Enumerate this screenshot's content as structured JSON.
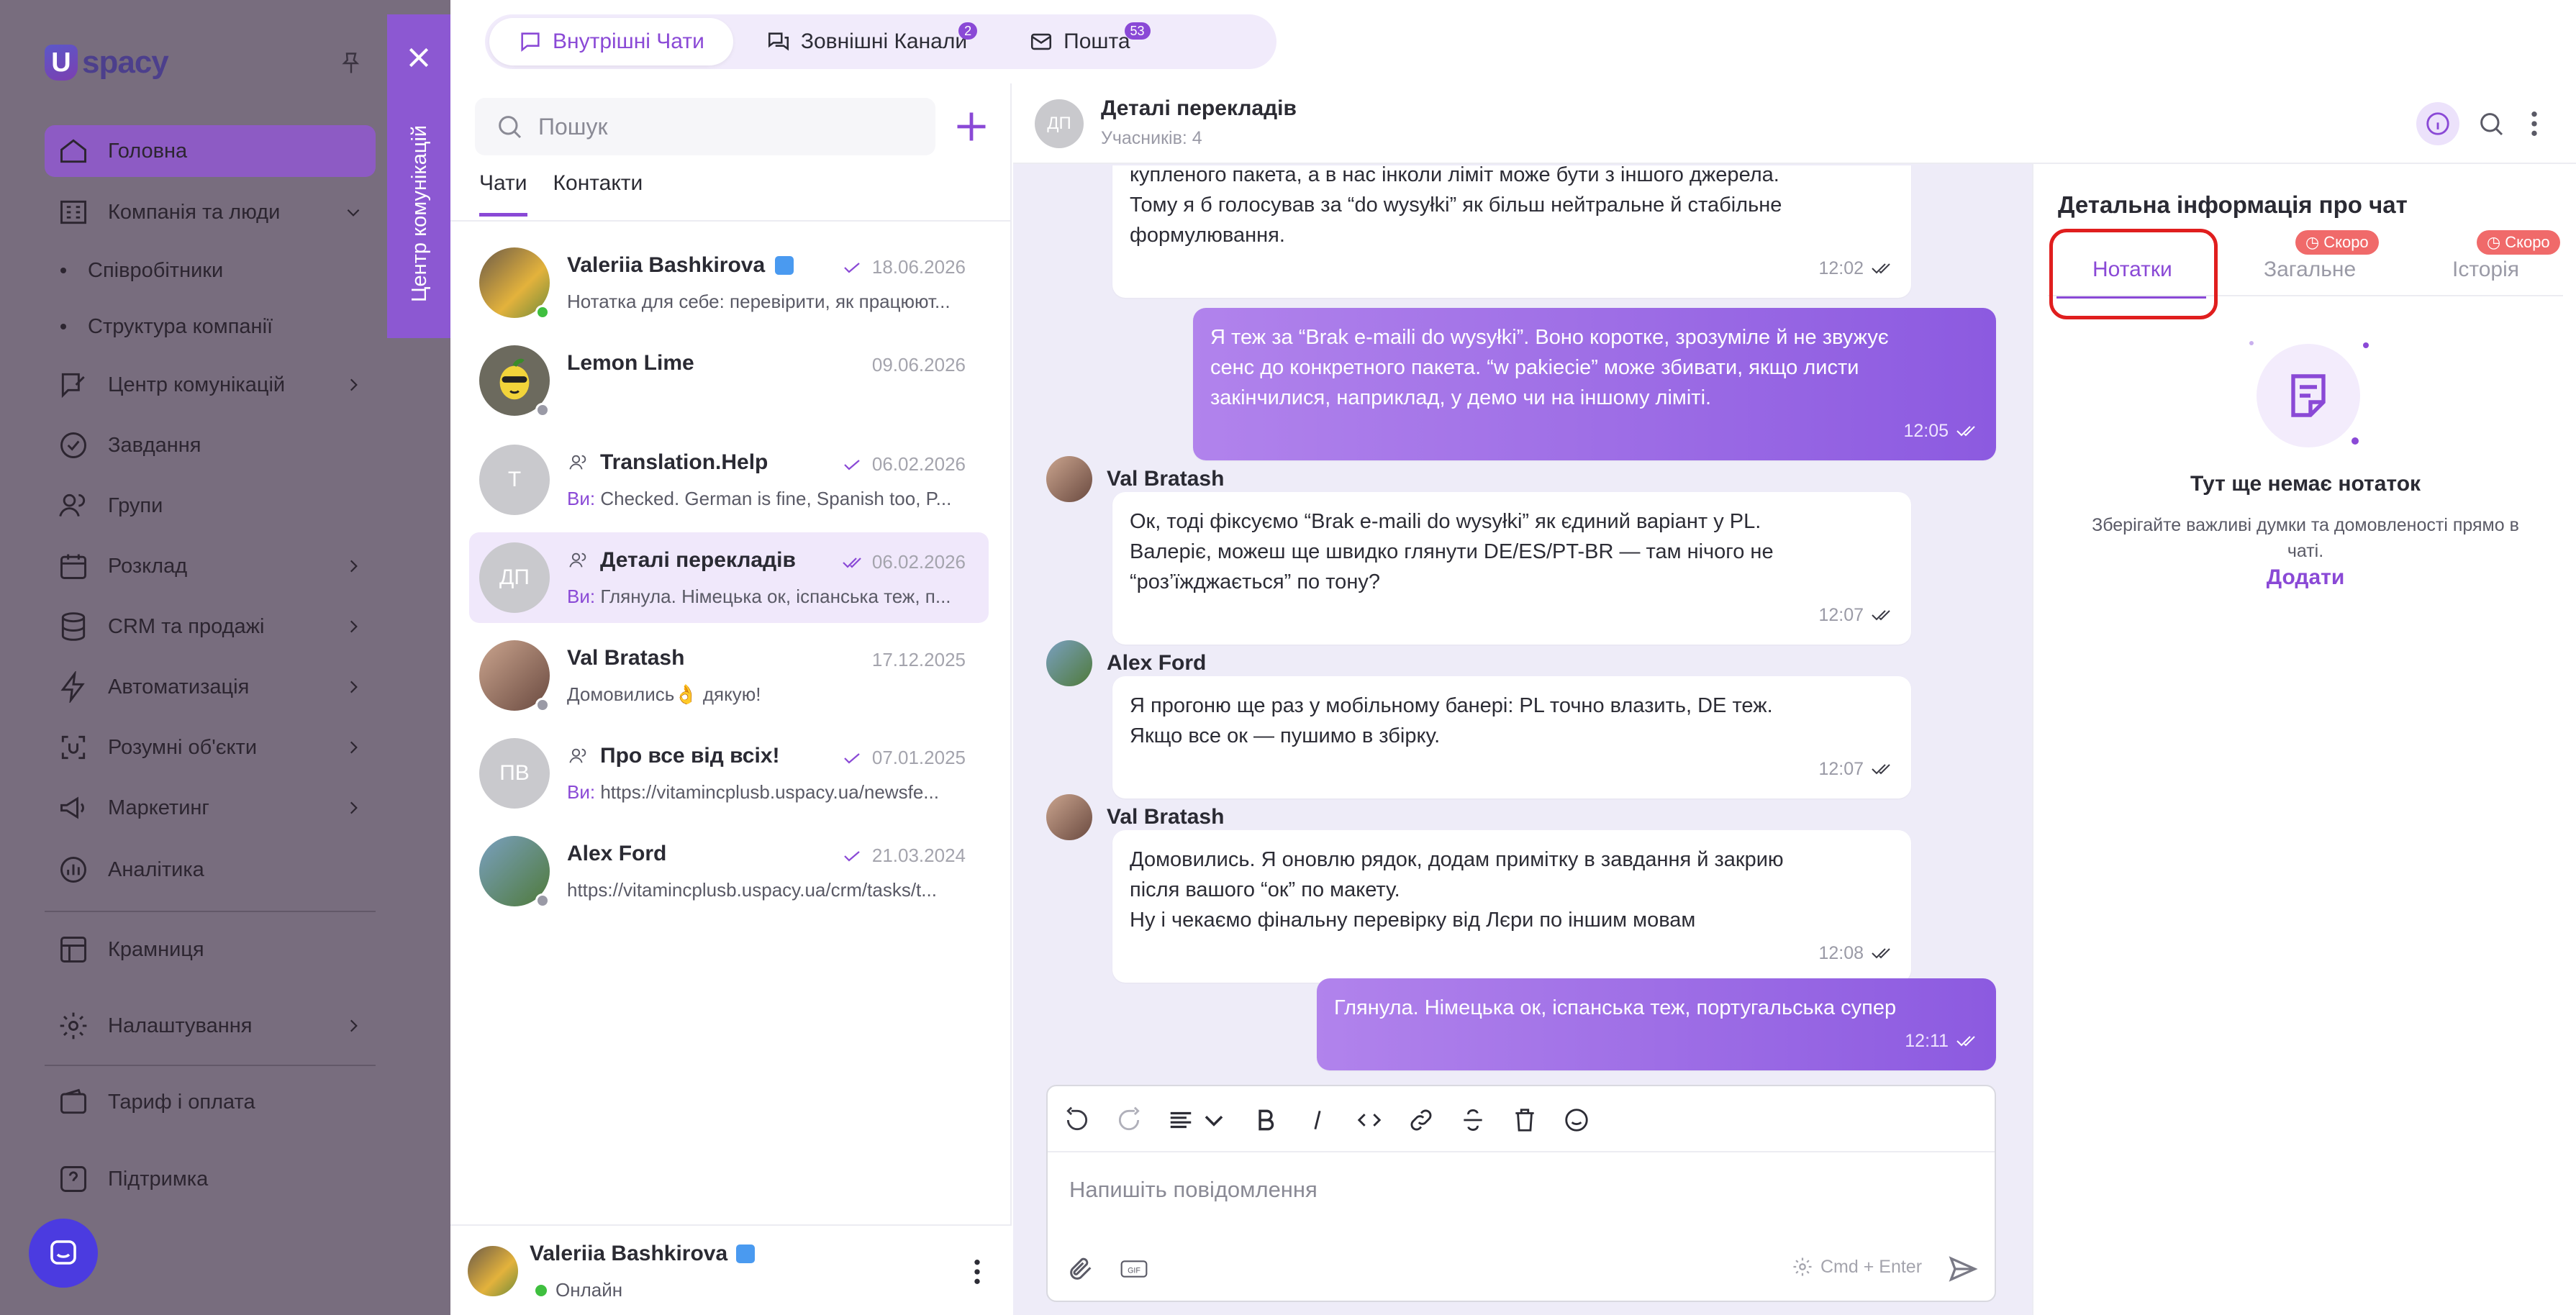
{
  "sidebar": {
    "logo_mark": "U",
    "logo_text": "spacy",
    "items": [
      {
        "label": "Головна"
      },
      {
        "label": "Компанія та люди"
      },
      {
        "label": "Співробітники"
      },
      {
        "label": "Структура компанії"
      },
      {
        "label": "Центр комунікацій"
      },
      {
        "label": "Завдання"
      },
      {
        "label": "Групи"
      },
      {
        "label": "Розклад"
      },
      {
        "label": "CRM та продажі"
      },
      {
        "label": "Автоматизація"
      },
      {
        "label": "Розумні об'єкти"
      },
      {
        "label": "Маркетинг"
      },
      {
        "label": "Аналітика"
      },
      {
        "label": "Крамниця"
      },
      {
        "label": "Налаштування"
      },
      {
        "label": "Тариф і оплата"
      },
      {
        "label": "Підтримка"
      }
    ],
    "side_tab_label": "Центр комунікацій"
  },
  "top_tabs": [
    {
      "label": "Внутрішні Чати",
      "badge": ""
    },
    {
      "label": "Зовнішні Канали",
      "badge": "2"
    },
    {
      "label": "Пошта",
      "badge": "53"
    }
  ],
  "chat_list": {
    "search_placeholder": "Пошук",
    "tabs": [
      "Чати",
      "Контакти"
    ],
    "chats": [
      {
        "name": "Valeriia Bashkirova",
        "date": "18.06.2026",
        "you": "",
        "message": "Нотатка для себе: перевірити, як працюют...",
        "initials": ""
      },
      {
        "name": "Lemon Lime",
        "date": "09.06.2026",
        "you": "",
        "message": "",
        "initials": ""
      },
      {
        "name": "Translation.Help",
        "date": "06.02.2026",
        "you": "Ви:",
        "message": "Checked. German is fine, Spanish too, P...",
        "initials": "T"
      },
      {
        "name": "Деталі перекладів",
        "date": "06.02.2026",
        "you": "Ви:",
        "message": "Глянула. Німецька ок, іспанська теж, п...",
        "initials": "ДП"
      },
      {
        "name": "Val Bratash",
        "date": "17.12.2025",
        "you": "",
        "message": "Домовились👌 дякую!",
        "initials": ""
      },
      {
        "name": "Про все від всіх!",
        "date": "07.01.2025",
        "you": "Ви:",
        "message": "https://vitamincplusb.uspacy.ua/newsfe...",
        "initials": "ПВ"
      },
      {
        "name": "Alex Ford",
        "date": "21.03.2024",
        "you": "",
        "message": "https://vitamincplusb.uspacy.ua/crm/tasks/t...",
        "initials": ""
      }
    ],
    "me": {
      "name": "Valeriia Bashkirova",
      "status": "Онлайн"
    }
  },
  "chat": {
    "initials": "ДП",
    "title": "Деталі перекладів",
    "members": "Учасників: 4",
    "messages": [
      {
        "sender": "",
        "lines": [
          "купленого пакета, а в нас інколи ліміт може бути з іншого джерела.",
          "Тому я б голосував за “do wysyłki” як більш нейтральне й стабільне",
          "формулювання."
        ],
        "time": "12:02"
      },
      {
        "sender": "me",
        "lines": [
          "Я теж за “Brak e-maili do wysyłki”. Воно коротке, зрозуміле й не звужує",
          "сенс до конкретного пакета. “w pakiecie” може збивати, якщо листи",
          "закінчилися, наприклад, у демо чи на іншому ліміті."
        ],
        "time": "12:05"
      },
      {
        "sender": "Val Bratash",
        "lines": [
          "Ок, тоді фіксуємо “Brak e-maili do wysyłki” як єдиний варіант у PL.",
          "Валеріє, можеш ще швидко глянути DE/ES/PT-BR — там нічого не",
          "“роз’їжджається” по тону?"
        ],
        "time": "12:07"
      },
      {
        "sender": "Alex Ford",
        "lines": [
          "Я прогоню ще раз у мобільному банері: PL точно влазить, DE теж.",
          "Якщо все ок — пушимо в збірку."
        ],
        "time": "12:07"
      },
      {
        "sender": "Val Bratash",
        "lines": [
          "Домовились. Я оновлю рядок, додам примітку в завдання й закрию",
          "після вашого “ок” по макету.",
          "Ну і чекаємо фінальну перевірку від Лєри по іншим мовам"
        ],
        "time": "12:08"
      },
      {
        "sender": "me",
        "lines": [
          "Глянула. Німецька ок, іспанська теж, португальська супер"
        ],
        "time": "12:11"
      }
    ],
    "composer": {
      "placeholder": "Напишіть повідомлення",
      "hint": "Cmd + Enter"
    }
  },
  "details": {
    "title": "Детальна інформація про чат",
    "tabs": [
      "Нотатки",
      "Загальне",
      "Історія"
    ],
    "soon": "Скоро",
    "empty_title": "Тут ще немає нотаток",
    "empty_text_1": "Зберігайте важливі думки та домовленості прямо в",
    "empty_text_2": "чаті.",
    "add": "Додати"
  },
  "colors": {
    "accent": "#8a49d6",
    "soon": "#f06a6a",
    "highlight": "#e01e1e",
    "online": "#3fbf3f"
  }
}
